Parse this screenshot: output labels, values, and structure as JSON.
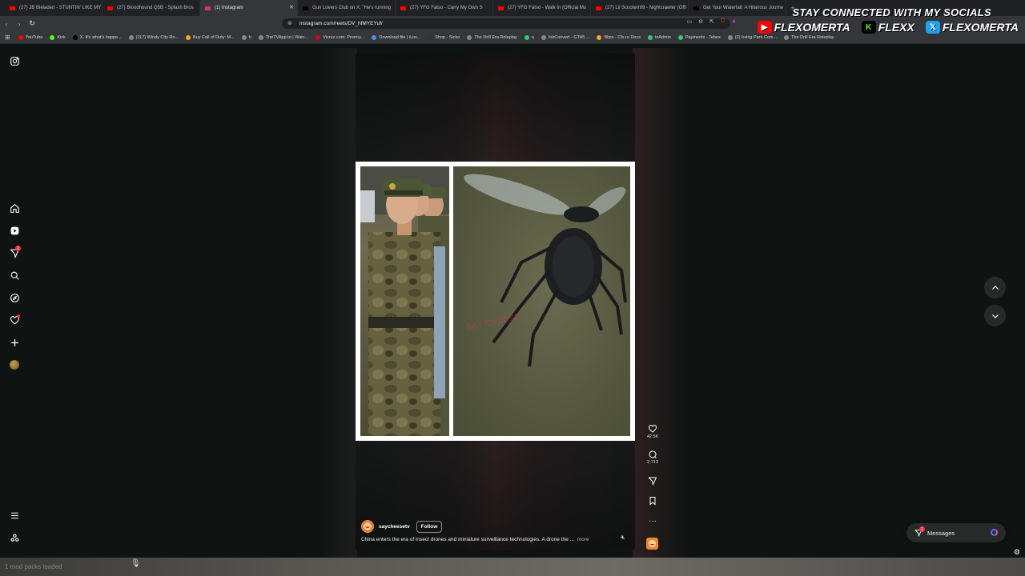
{
  "browser": {
    "tabs": [
      {
        "title": "(27) JB Bieladen - STUNTIN' LIKE MY",
        "color": "#ff0000",
        "active": false
      },
      {
        "title": "(27) Bloodhound Q5B - Splash Bros",
        "color": "#ff0000",
        "active": false
      },
      {
        "title": "(1) Instagram",
        "color": "#e1306c",
        "active": true
      },
      {
        "title": "Gun Lovers Club on X: \"He's running",
        "color": "#000000",
        "active": false
      },
      {
        "title": "(27) YFG Fatso - Carry My Own S",
        "color": "#ff0000",
        "active": false
      },
      {
        "title": "(27) YFG Fatso - Walk In (Official Mu",
        "color": "#ff0000",
        "active": false
      },
      {
        "title": "(27) Lil Scooterr89 - Nightcrawler (Offi",
        "color": "#ff0000",
        "active": false
      },
      {
        "title": "Get Your Waterfall: A Hilarious Journe",
        "color": "#000000",
        "active": false
      }
    ],
    "new_tab": "+",
    "url": "instagram.com/reels/DV_hfMYEYuf/",
    "bookmarks": [
      {
        "label": "YouTube",
        "color": "#ff0000"
      },
      {
        "label": "Kick",
        "color": "#53fc18"
      },
      {
        "label": "X. It's what's happe...",
        "color": "#000000"
      },
      {
        "label": "(117) Windy City Ro...",
        "color": "#888888"
      },
      {
        "label": "Buy Call of Duty: M...",
        "color": "#f5a623"
      },
      {
        "label": "b",
        "color": "#888888"
      },
      {
        "label": "TheTVApp.to | Watc...",
        "color": "#888888"
      },
      {
        "label": "Vicrez.com: Premiu...",
        "color": "#d0021b"
      },
      {
        "label": "Download file | iLov...",
        "color": "#4a90e2"
      },
      {
        "label": "Shop - Sicko",
        "color": "#333333"
      },
      {
        "label": "The Drill Era Roleplay",
        "color": "#888888"
      },
      {
        "label": "a",
        "color": "#2ecc71"
      },
      {
        "label": "InkConvert - GTA5 ...",
        "color": "#888888"
      },
      {
        "label": "Blips - Cfx.re Docs",
        "color": "#f5a623"
      },
      {
        "label": "txAdmin",
        "color": "#2ecc71"
      },
      {
        "label": "Payments - Tebex",
        "color": "#2ecc71"
      },
      {
        "label": "(2) Irving Park Com...",
        "color": "#888888"
      },
      {
        "label": "The Drill Era Roleplay",
        "color": "#888888"
      }
    ]
  },
  "overlay": {
    "title": "STAY CONNECTED WITH MY SOCIALS",
    "youtube": "FLEXOMERTA",
    "kick": "FLEXX",
    "x": "FLEXOMERTA"
  },
  "instagram": {
    "reel": {
      "watermark": "SAY CHEESE",
      "likes": "42.5K",
      "comments": "2,713",
      "author": "saycheesetv",
      "follow_label": "Follow",
      "caption": "China enters the era of insect drones and miniature surveillance technologies. A drone the ...",
      "more_label": "more"
    },
    "notifications_badge": "1",
    "messages": {
      "label": "Messages",
      "badge": "1"
    }
  },
  "taskbar": {
    "text": "1 mod packs loaded"
  },
  "colors": {
    "accent": "#ff3040",
    "background": "#0f1413",
    "audio_thumb": "#f1862a"
  }
}
